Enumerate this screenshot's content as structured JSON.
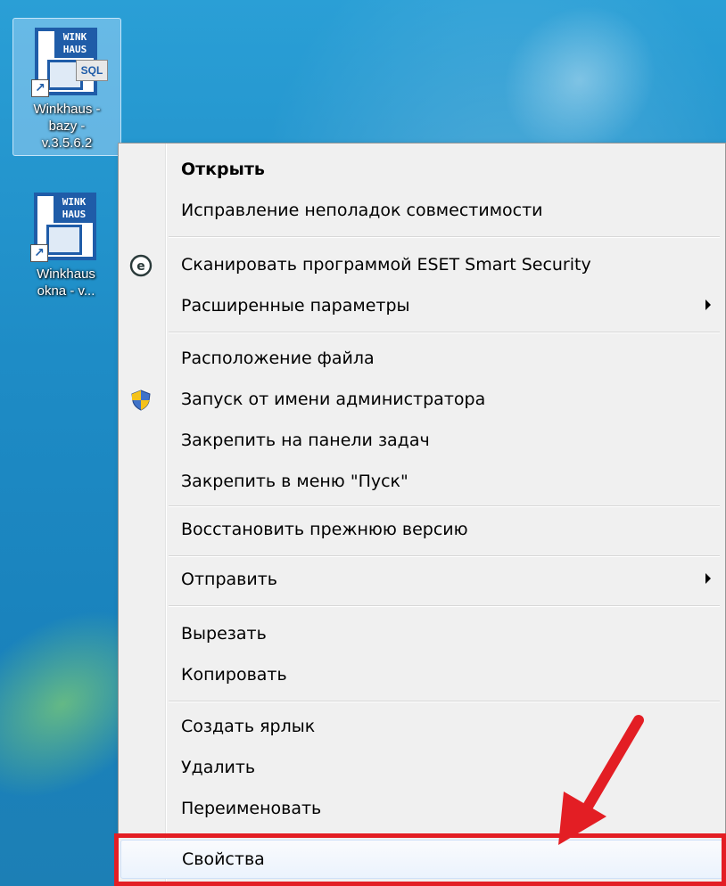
{
  "desktop": {
    "icons": [
      {
        "label_lines": [
          "Winkhaus -",
          "bazy -",
          "v.3.5.6.2"
        ],
        "logo": "WINK HAUS",
        "badge": "SQL",
        "selected": true
      },
      {
        "label_lines": [
          "Winkhaus",
          "okna - v..."
        ],
        "logo": "WINK HAUS",
        "badge": "",
        "selected": false
      }
    ]
  },
  "context_menu": {
    "items": {
      "open": "Открыть",
      "compat": "Исправление неполадок совместимости",
      "eset": "Сканировать программой ESET Smart Security",
      "advanced": "Расширенные параметры",
      "location": "Расположение файла",
      "run_admin": "Запуск от имени администратора",
      "pin_taskbar": "Закрепить на панели задач",
      "pin_start": "Закрепить в меню \"Пуск\"",
      "restore": "Восстановить прежнюю версию",
      "send_to": "Отправить",
      "cut": "Вырезать",
      "copy": "Копировать",
      "create_shortcut": "Создать ярлык",
      "delete": "Удалить",
      "rename": "Переименовать",
      "properties": "Свойства"
    },
    "icons": {
      "eset": "eset-icon",
      "run_admin": "uac-shield-icon"
    }
  },
  "colors": {
    "highlight_border": "#e31e24",
    "arrow": "#e31e24",
    "desktop_blue": "#1e8cc6",
    "menu_bg": "#f0f0f0"
  }
}
